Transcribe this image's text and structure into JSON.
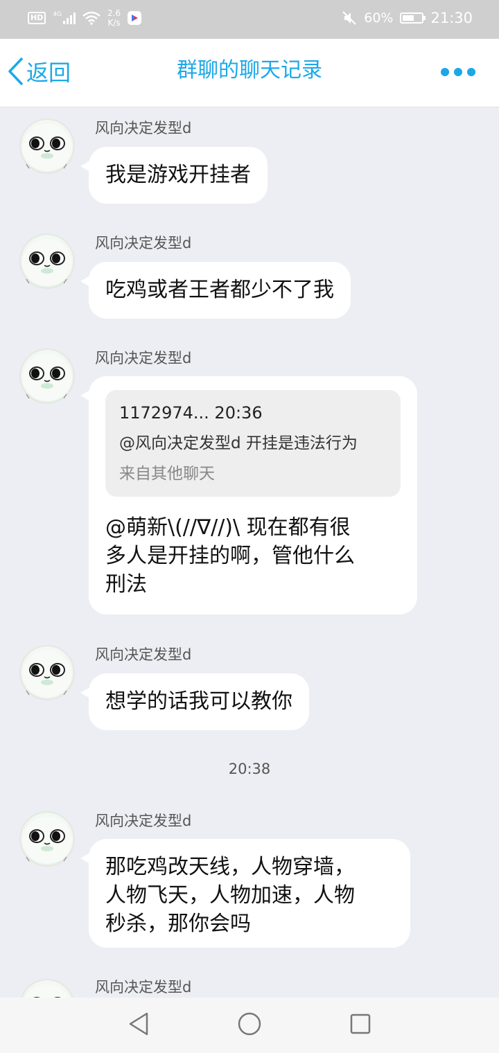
{
  "status_bar": {
    "hd": "HD",
    "network": "4G",
    "speed_value": "2.6",
    "speed_unit": "K/s",
    "battery": "60%",
    "battery_level": 0.6,
    "time": "21:30"
  },
  "header": {
    "back_label": "返回",
    "title": "群聊的聊天记录",
    "accent_color": "#1ba8e8"
  },
  "messages": [
    {
      "sender": "风向决定发型d",
      "text": "我是游戏开挂者"
    },
    {
      "sender": "风向决定发型d",
      "text": "吃鸡或者王者都少不了我"
    },
    {
      "sender": "风向决定发型d",
      "quote": {
        "name": "1172974...",
        "time": "20:36",
        "text": "@风向决定发型d 开挂是违法行为",
        "source": "来自其他聊天"
      },
      "lines": [
        "@萌新\\(//∇//)\\ 现在都有很",
        "多人是开挂的啊，管他什么",
        "刑法"
      ]
    },
    {
      "sender": "风向决定发型d",
      "text": "想学的话我可以教你"
    },
    {
      "sender": "风向决定发型d",
      "lines": [
        "那吃鸡改天线，人物穿墙，",
        "人物飞天，人物加速，人物",
        "秒杀，那你会吗"
      ]
    },
    {
      "sender": "风向决定发型d"
    }
  ],
  "timestamp": "20:38"
}
